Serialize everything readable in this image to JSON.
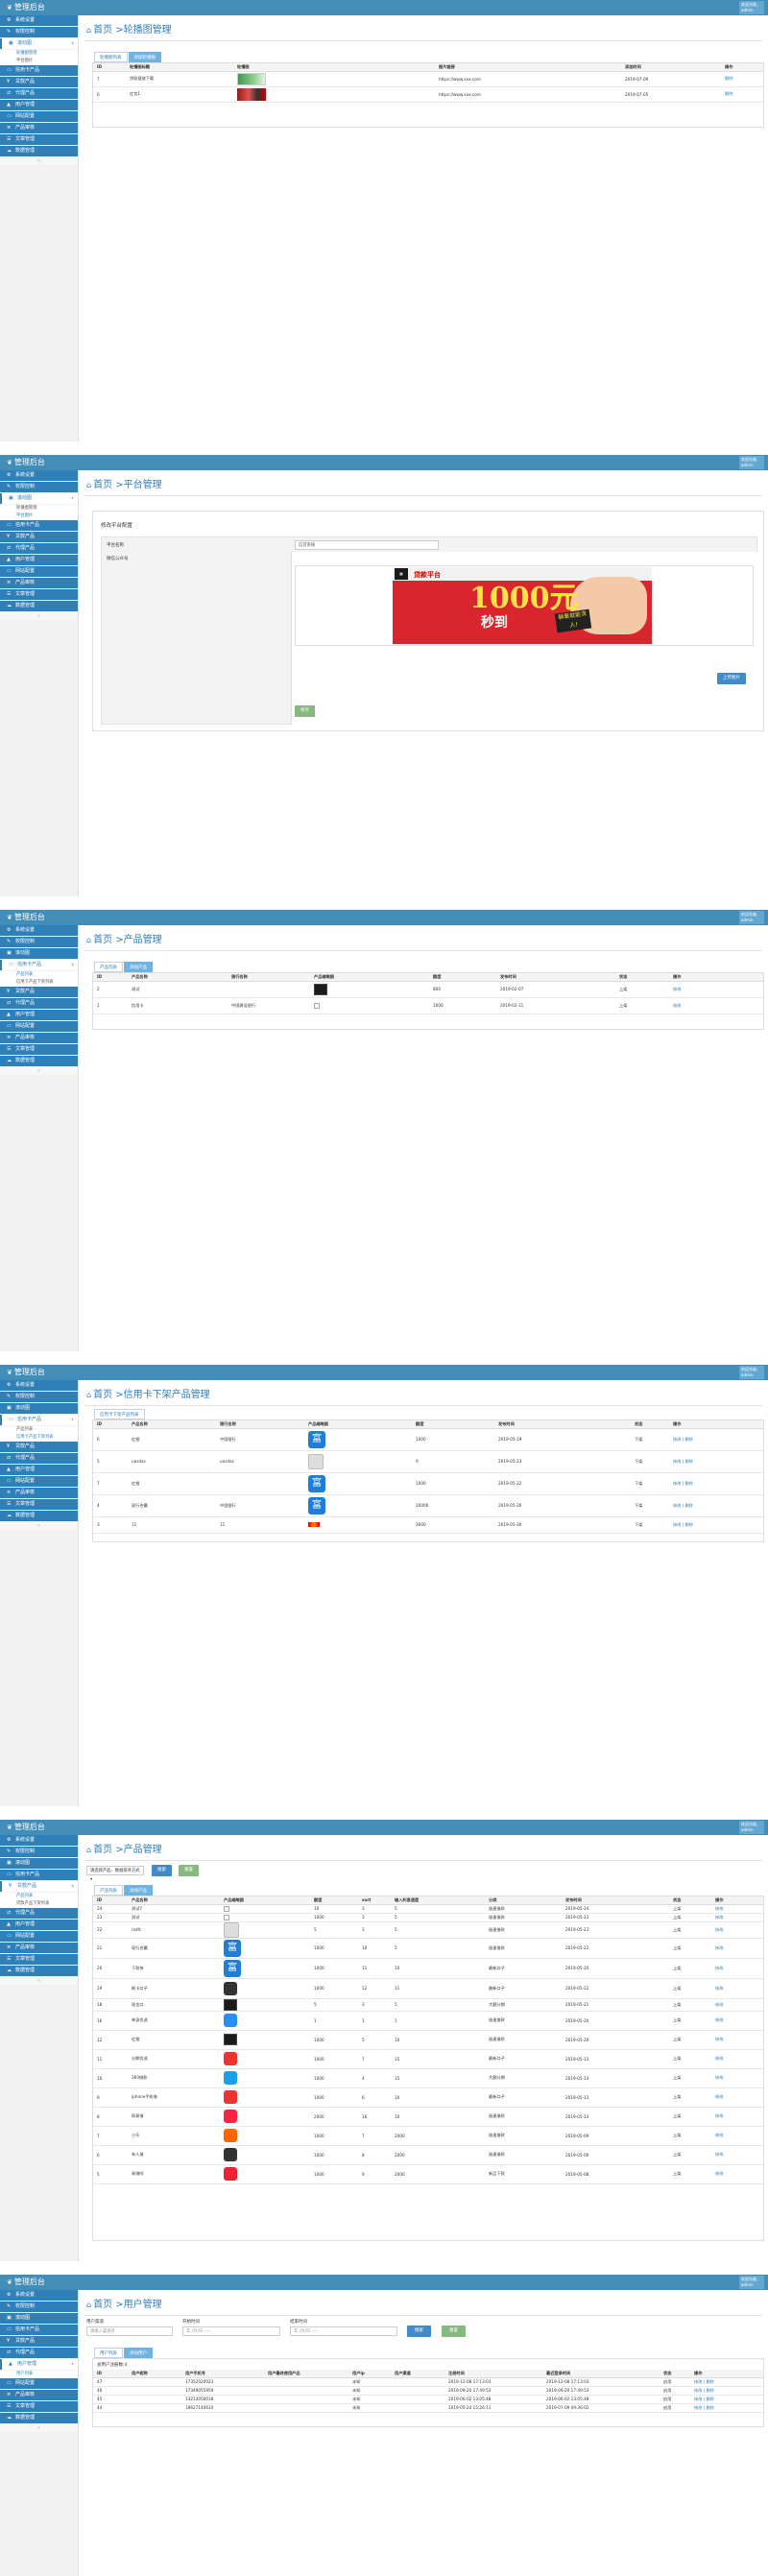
{
  "brand": "管理后台",
  "user": {
    "line1": "欢迎光临,",
    "line2": "admin"
  },
  "nav": [
    "系统设置",
    "权限控制",
    "滚动图",
    "信用卡产品",
    "贷款产品",
    "代理产品",
    "用户管理",
    "网站配置",
    "产品审核",
    "文章管理",
    "数据管理"
  ],
  "fold": "«",
  "panel1": {
    "sub": [
      "轮播图管理",
      "平台图片"
    ],
    "title": "首页 >轮播图管理",
    "tabs": [
      "轮播图列表",
      "添加轮播图"
    ],
    "headers": [
      "ID",
      "轮播图标题",
      "轮播图",
      "图片链接",
      "添加时间",
      "操作"
    ],
    "rows": [
      {
        "id": "7",
        "name": "贷款速放下载",
        "url": "https://www.xxx.com",
        "time": "2019-07-09",
        "op": "删除"
      },
      {
        "id": "6",
        "name": "红包1",
        "url": "https://www.xxx.com",
        "time": "2019-07-05",
        "op": "删除"
      }
    ]
  },
  "panel2": {
    "sub": [
      "轮播图管理",
      "平台图片"
    ],
    "title": "首页 >平台管理",
    "section": "修改平台配置",
    "label1": "平台名称",
    "value1": "信贷系统",
    "label2": "微信公众号",
    "upload": "上传图片",
    "save": "保存",
    "banner": {
      "brand": "贷款平台",
      "big": "1000元",
      "small": "秒到",
      "bubble": "躺着就能求人!"
    }
  },
  "panel3": {
    "sub": [
      "产品列表",
      "信用卡产品下架列表"
    ],
    "title": "首页 >产品管理",
    "tabs": [
      "产品列表",
      "添加产品"
    ],
    "headers": [
      "ID",
      "产品名称",
      "银行名称",
      "产品缩略图",
      "额度",
      "发布时间",
      "状态",
      "操作"
    ],
    "rows": [
      {
        "id": "2",
        "name": "测试",
        "bank": "",
        "amt": "800",
        "time": "2019-02-07",
        "st": "上架",
        "op": "修改"
      },
      {
        "id": "1",
        "name": "信用卡",
        "bank": "中国建设银行",
        "amt": "1000",
        "time": "2019-02-11",
        "st": "上架",
        "op": "修改"
      }
    ]
  },
  "panel4": {
    "sub": [
      "产品列表",
      "信用卡产品下架列表"
    ],
    "title": "首页 >信用卡下架产品管理",
    "tabs": [
      "信用卡下架产品列表"
    ],
    "headers": [
      "ID",
      "产品名称",
      "银行名称",
      "产品缩略图",
      "额度",
      "发布时间",
      "状态",
      "操作"
    ],
    "rows": [
      {
        "id": "6",
        "name": "红橙",
        "bank": "中国银行",
        "amt": "1000",
        "time": "2019-05-19",
        "st": "下架",
        "op": "修改 | 删除"
      },
      {
        "id": "5",
        "name": "uasdas",
        "bank": "uasdas",
        "amt": "9",
        "time": "2019-05-23",
        "st": "下架",
        "op": "修改 | 删除"
      },
      {
        "id": "7",
        "name": "红橙",
        "bank": "",
        "amt": "1000",
        "time": "2019-05-22",
        "st": "下架",
        "op": "修改 | 删除"
      },
      {
        "id": "4",
        "name": "现行合赢",
        "bank": "中国银行",
        "amt": "20000",
        "time": "2019-05-26",
        "st": "下架",
        "op": "修改 | 删除"
      },
      {
        "id": "3",
        "name": "11",
        "bank": "11",
        "amt": "3000",
        "time": "2019-05-30",
        "st": "下架",
        "op": "修改 | 删除"
      }
    ]
  },
  "panel5": {
    "sub": [
      "产品列表",
      "贷款产品下架列表"
    ],
    "title": "首页 >产品管理",
    "filter_select": "请选择产品、数据排序方式",
    "search": "搜索",
    "reset": "重置",
    "tabs": [
      "产品列表",
      "添加产品"
    ],
    "headers": [
      "ID",
      "产品名称",
      "产品缩略图",
      "额度",
      "sort",
      "输入利息速度",
      "分类",
      "发布时间",
      "状态",
      "操作"
    ],
    "rows": [
      {
        "id": "24",
        "name": "测试7",
        "amt": "10",
        "sort": "3",
        "speed": "5",
        "cat": "极速借款",
        "time": "2019-05-24",
        "st": "上架"
      },
      {
        "id": "23",
        "name": "测试",
        "amt": "1000",
        "sort": "3",
        "speed": "5",
        "cat": "极速借款",
        "time": "2019-05-23",
        "st": "上架"
      },
      {
        "id": "22",
        "name": "rsdfc",
        "amt": "5",
        "sort": "3",
        "speed": "5",
        "cat": "极速借款",
        "time": "2019-05-23",
        "st": "上架"
      },
      {
        "id": "21",
        "name": "现行合赢",
        "amt": "1000",
        "sort": "10",
        "speed": "5",
        "cat": "极速借款",
        "time": "2019-05-22",
        "st": "上架"
      },
      {
        "id": "20",
        "name": "下款快",
        "amt": "1000",
        "sort": "11",
        "speed": "10",
        "cat": "最新口子",
        "time": "2019-05-20",
        "st": "上架"
      },
      {
        "id": "19",
        "name": "刷卡口子",
        "amt": "1000",
        "sort": "12",
        "speed": "11",
        "cat": "最新口子",
        "time": "2019-05-22",
        "st": "上架"
      },
      {
        "id": "18",
        "name": "现金口",
        "amt": "5",
        "sort": "3",
        "speed": "5",
        "cat": "大额分期",
        "time": "2019-05-21",
        "st": "上架"
      },
      {
        "id": "16",
        "name": "单身优选",
        "amt": "1",
        "sort": "1",
        "speed": "1",
        "cat": "极速借款",
        "time": "2019-05-20",
        "st": "上架"
      },
      {
        "id": "12",
        "name": "红橙",
        "amt": "1000",
        "sort": "5",
        "speed": "10",
        "cat": "极速借款",
        "time": "2019-05-20",
        "st": "上架"
      },
      {
        "id": "11",
        "name": "分期优选",
        "amt": "1000",
        "sort": "7",
        "speed": "15",
        "cat": "最新口子",
        "time": "2019-05-13",
        "st": "上架"
      },
      {
        "id": "10",
        "name": "360借款",
        "amt": "1000",
        "sort": "4",
        "speed": "15",
        "cat": "大额分期",
        "time": "2019-05-13",
        "st": "上架"
      },
      {
        "id": "9",
        "name": "iphone手机借",
        "amt": "1000",
        "sort": "6",
        "speed": "10",
        "cat": "最新口子",
        "time": "2019-05-13",
        "st": "上架"
      },
      {
        "id": "8",
        "name": "网易借",
        "amt": "2000",
        "sort": "16",
        "speed": "10",
        "cat": "极速借款",
        "time": "2019-05-13",
        "st": "上架"
      },
      {
        "id": "7",
        "name": "小乐",
        "amt": "1000",
        "sort": "7",
        "speed": "2000",
        "cat": "极速借款",
        "time": "2019-05-09",
        "st": "上架"
      },
      {
        "id": "6",
        "name": "有人借",
        "amt": "1000",
        "sort": "8",
        "speed": "2000",
        "cat": "极速借款",
        "time": "2019-05-09",
        "st": "上架"
      },
      {
        "id": "5",
        "name": "易借呗",
        "amt": "1000",
        "sort": "9",
        "speed": "2000",
        "cat": "新品下款",
        "time": "2019-05-08",
        "st": "上架"
      }
    ],
    "op": "修改"
  },
  "panel6": {
    "sub": [
      "用户列表"
    ],
    "title": "首页 >用户管理",
    "f1_label": "用户渠道",
    "f1_ph": "请输入渠道名",
    "f2_label": "开始时间",
    "f2_ph": "年 /月/日  --:--",
    "f3_label": "结束时间",
    "f3_ph": "年 /月/日  --:--",
    "search": "搜索",
    "reset": "重置",
    "tabs": [
      "用户列表",
      "添加用户"
    ],
    "total": "总用户注册数:4",
    "headers": [
      "ID",
      "用户昵称",
      "用户手机号",
      "用户最终使用产品",
      "用户ip",
      "用户渠道",
      "注册时间",
      "最近登录时间",
      "状态",
      "操作"
    ],
    "rows": [
      {
        "id": "47",
        "phone": "17352020023",
        "ip": "未知",
        "reg": "2019-12-08 17:13:03",
        "last": "2019-12-08 17:13:03",
        "st": "启用"
      },
      {
        "id": "46",
        "phone": "17349055959",
        "ip": "未知",
        "reg": "2019-09-20 17:49:53",
        "last": "2019-09-20 17:49:53",
        "st": "启用"
      },
      {
        "id": "45",
        "phone": "13213056018",
        "ip": "未知",
        "reg": "2019-06-02 13:05:48",
        "last": "2019-06-02 13:05:48",
        "st": "启用"
      },
      {
        "id": "44",
        "phone": "18627140610",
        "ip": "未知",
        "reg": "2019-05-24 15:26:11",
        "last": "2019-07-09 09:36:02",
        "st": "启用"
      }
    ],
    "op": "修改 | 删除"
  }
}
